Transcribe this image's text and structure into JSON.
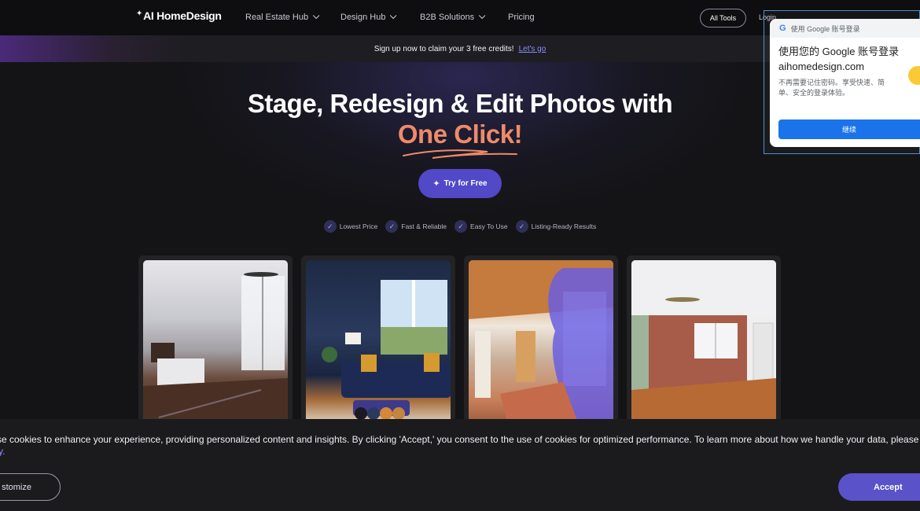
{
  "nav": {
    "logo": "AI HomeDesign",
    "items": [
      {
        "label": "Real Estate Hub",
        "has_dropdown": true
      },
      {
        "label": "Design Hub",
        "has_dropdown": true
      },
      {
        "label": "B2B Solutions",
        "has_dropdown": true
      },
      {
        "label": "Pricing",
        "has_dropdown": false
      }
    ],
    "all_tools": "All Tools",
    "login": "Login"
  },
  "promo": {
    "text": "Sign up now to claim your 3 free credits!",
    "cta": "Let's go"
  },
  "hero": {
    "headline": "Stage, Redesign & Edit Photos with",
    "headline_accent": "One Click!",
    "try_button": "Try for Free",
    "features": [
      "Lowest Price",
      "Fast & Reliable",
      "Easy To Use",
      "Listing-Ready Results"
    ]
  },
  "google_popup": {
    "header": "使用 Google 账号登录",
    "title": "使用您的 Google 账号登录 aihomedesign.com",
    "description": "不再需要记住密码。享受快速、简单、安全的登录体验。",
    "continue": "继续"
  },
  "cookie": {
    "text": "se cookies to enhance your experience, providing personalized content and insights. By clicking 'Accept,' you consent to the use of cookies for optimized performance. To learn more about how we handle your data, please revi",
    "text_line2": "y.",
    "customize": "stomize",
    "accept": "Accept"
  },
  "colors": {
    "accent": "#5149c7",
    "headline_accent": "#ef8a6a",
    "background": "#141416"
  }
}
